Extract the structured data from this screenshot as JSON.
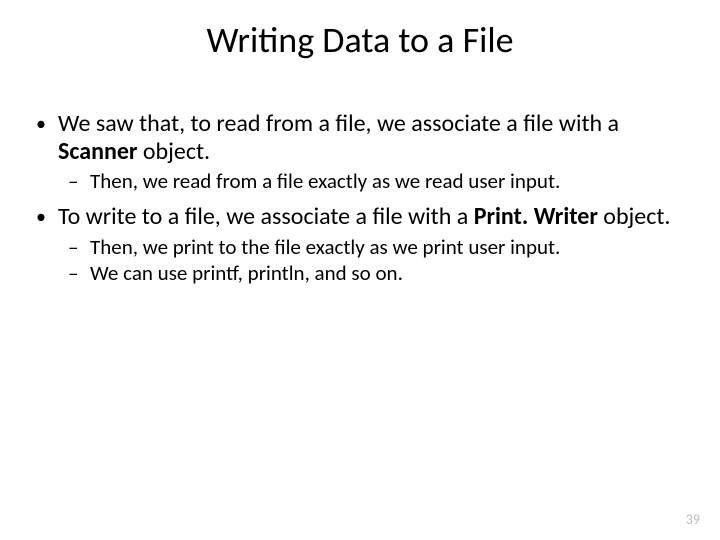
{
  "title": "Writing Data to a File",
  "bullets": [
    {
      "pre": "We saw that, to read from a file, we associate a file with a ",
      "bold": "Scanner",
      "post": " object.",
      "sub": [
        "Then, we read from a file exactly as we read user input."
      ]
    },
    {
      "pre": "To write to a file, we associate a file with a ",
      "bold": "Print. Writer",
      "post": " object.",
      "sub": [
        "Then, we print to the file exactly as we print user input.",
        "We can use printf, println, and so on."
      ]
    }
  ],
  "page_number": "39"
}
